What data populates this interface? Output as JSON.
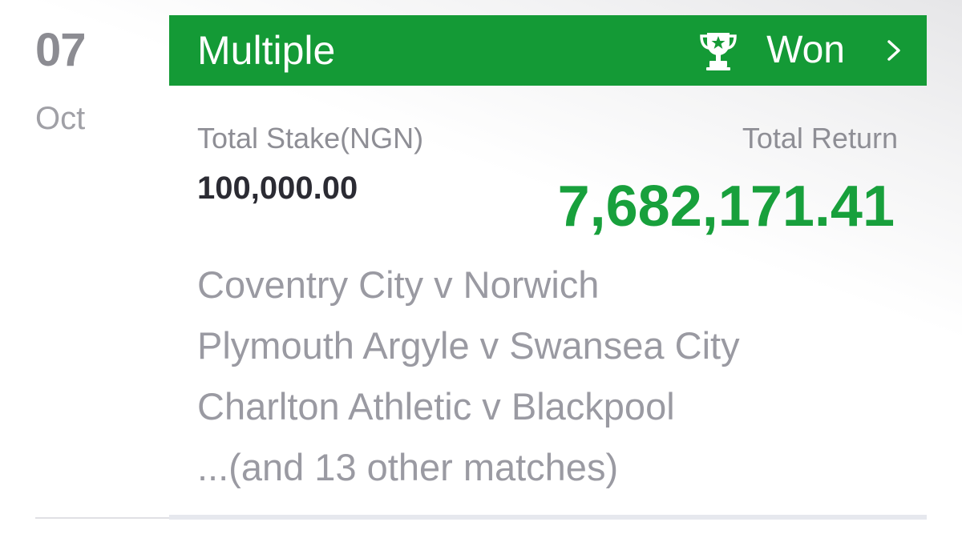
{
  "date": {
    "day": "07",
    "month": "Oct"
  },
  "bet": {
    "type": "Multiple",
    "status": "Won",
    "icons": {
      "status": "trophy-icon",
      "navigate": "chevron-right-icon"
    },
    "colors": {
      "header_background": "#149a36",
      "return_value": "#18a03c"
    }
  },
  "stake": {
    "label": "Total Stake(NGN)",
    "value": "100,000.00"
  },
  "return": {
    "label": "Total Return",
    "value": "7,682,171.41"
  },
  "matches": [
    "Coventry City v Norwich",
    "Plymouth Argyle v Swansea City",
    "Charlton Athletic v Blackpool",
    "...(and 13 other matches)"
  ]
}
